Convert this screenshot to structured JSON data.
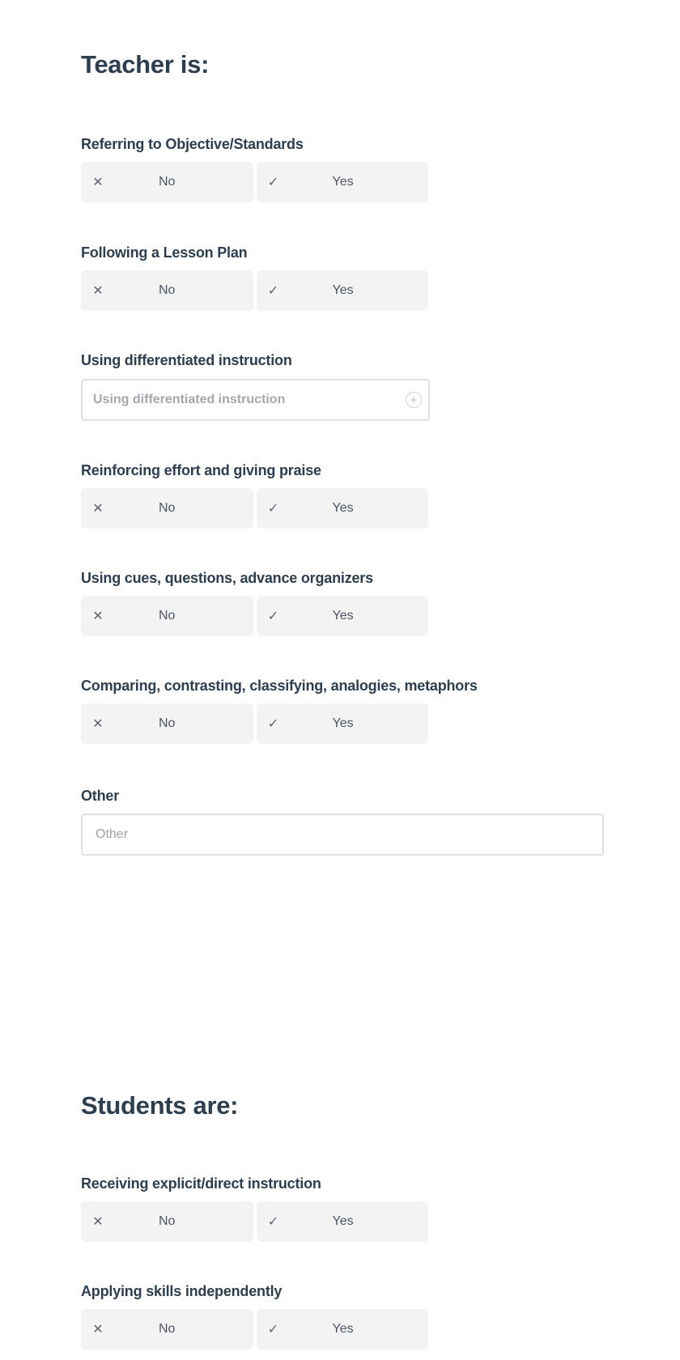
{
  "sections": [
    {
      "title": "Teacher is:",
      "fields": [
        {
          "label": "Referring to Objective/Standards",
          "type": "toggle",
          "options": [
            {
              "icon": "x-icon",
              "label": "No"
            },
            {
              "icon": "check-icon",
              "label": "Yes"
            }
          ]
        },
        {
          "label": "Following a Lesson Plan",
          "type": "toggle",
          "options": [
            {
              "icon": "x-icon",
              "label": "No"
            },
            {
              "icon": "check-icon",
              "label": "Yes"
            }
          ]
        },
        {
          "label": "Using differentiated instruction",
          "type": "select",
          "placeholder": "Using differentiated instruction",
          "icon": "plus-circle-icon"
        },
        {
          "label": "Reinforcing effort and giving praise",
          "type": "toggle",
          "options": [
            {
              "icon": "x-icon",
              "label": "No"
            },
            {
              "icon": "check-icon",
              "label": "Yes"
            }
          ]
        },
        {
          "label": "Using cues, questions, advance organizers",
          "type": "toggle",
          "options": [
            {
              "icon": "x-icon",
              "label": "No"
            },
            {
              "icon": "check-icon",
              "label": "Yes"
            }
          ]
        },
        {
          "label": "Comparing, contrasting, classifying, analogies, metaphors",
          "type": "toggle",
          "options": [
            {
              "icon": "x-icon",
              "label": "No"
            },
            {
              "icon": "check-icon",
              "label": "Yes"
            }
          ]
        },
        {
          "label": "Other",
          "type": "text",
          "placeholder": "Other",
          "value": ""
        }
      ]
    },
    {
      "title": "Students are:",
      "fields": [
        {
          "label": "Receiving explicit/direct instruction",
          "type": "toggle",
          "options": [
            {
              "icon": "x-icon",
              "label": "No"
            },
            {
              "icon": "check-icon",
              "label": "Yes"
            }
          ]
        },
        {
          "label": "Applying skills independently",
          "type": "toggle",
          "options": [
            {
              "icon": "x-icon",
              "label": "No"
            },
            {
              "icon": "check-icon",
              "label": "Yes"
            }
          ]
        }
      ]
    }
  ],
  "glyphs": {
    "x": "✕",
    "check": "✓",
    "plus": "+"
  }
}
